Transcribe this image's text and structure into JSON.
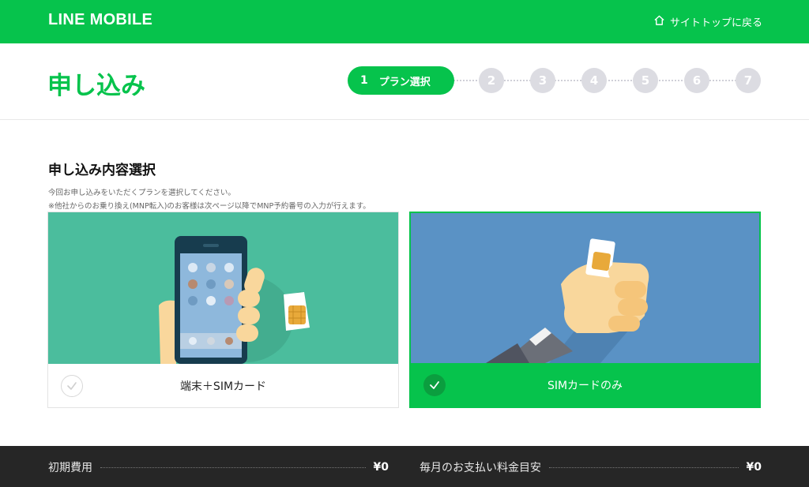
{
  "brand": {
    "logo_text": "LINE MOBILE",
    "accent": "#06c34c"
  },
  "nav": {
    "back_label": "サイトトップに戻る",
    "home_icon": "home-icon"
  },
  "page": {
    "title": "申し込み"
  },
  "stepper": {
    "current": {
      "number": "1",
      "label": "プラン選択"
    },
    "steps": [
      "2",
      "3",
      "4",
      "5",
      "6",
      "7"
    ]
  },
  "section": {
    "title": "申し込み内容選択",
    "description_1": "今回お申し込みをいただくプランを選択してください。",
    "description_2": "※他社からのお乗り換え(MNP転入)のお客様は次ページ以降でMNP予約番号の入力が行えます。"
  },
  "options": [
    {
      "label": "端末＋SIMカード",
      "selected": false,
      "illustration": "phone-with-sim",
      "bg_color": "#4bbd9d"
    },
    {
      "label": "SIMカードのみ",
      "selected": true,
      "illustration": "hand-holding-sim",
      "bg_color": "#5a92c5"
    }
  ],
  "summary": {
    "initial_fee_label": "初期費用",
    "initial_fee_value": "¥0",
    "monthly_fee_label": "毎月のお支払い料金目安",
    "monthly_fee_value": "¥0"
  }
}
